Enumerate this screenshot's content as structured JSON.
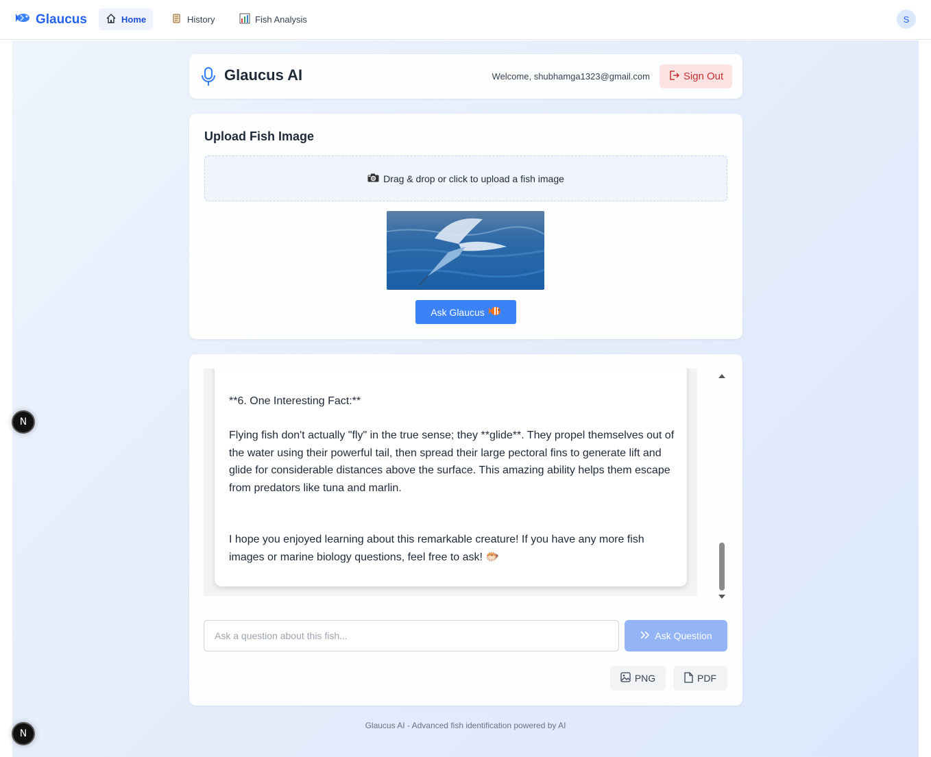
{
  "navbar": {
    "brand": "Glaucus",
    "links": [
      {
        "label": "Home",
        "icon": "home-icon",
        "active": true
      },
      {
        "label": "History",
        "icon": "scroll-icon",
        "active": false
      },
      {
        "label": "Fish Analysis",
        "icon": "bar-chart-icon",
        "active": false
      }
    ],
    "avatar_initial": "S"
  },
  "header": {
    "title": "Glaucus AI",
    "welcome": "Welcome, shubhamga1323@gmail.com",
    "sign_out": "Sign Out"
  },
  "upload": {
    "title": "Upload Fish Image",
    "dropzone_text": "Drag & drop or click to upload a fish image",
    "ask_button": "Ask Glaucus"
  },
  "chat": {
    "heading": "**6. One Interesting Fact:**",
    "fact": "Flying fish don't actually \"fly\" in the true sense; they **glide**.  They propel themselves out of the water using their powerful tail, then spread their large pectoral fins to generate lift and glide for considerable distances above the surface.  This amazing ability helps them escape from predators like tuna and marlin.",
    "closing": "I hope you enjoyed learning about this remarkable creature!  If you have any more fish images or marine biology questions, feel free to ask! 🐡",
    "input_placeholder": "Ask a question about this fish...",
    "ask_question": "Ask Question",
    "export_png": "PNG",
    "export_pdf": "PDF"
  },
  "footer": "Glaucus AI - Advanced fish identification powered by AI",
  "dev_badge": "N",
  "colors": {
    "brand": "#2563eb",
    "primary_button": "#3b82f6",
    "disabled_button": "#93b4f5",
    "sign_out_bg": "#fde2e2",
    "sign_out_text": "#c53030"
  }
}
